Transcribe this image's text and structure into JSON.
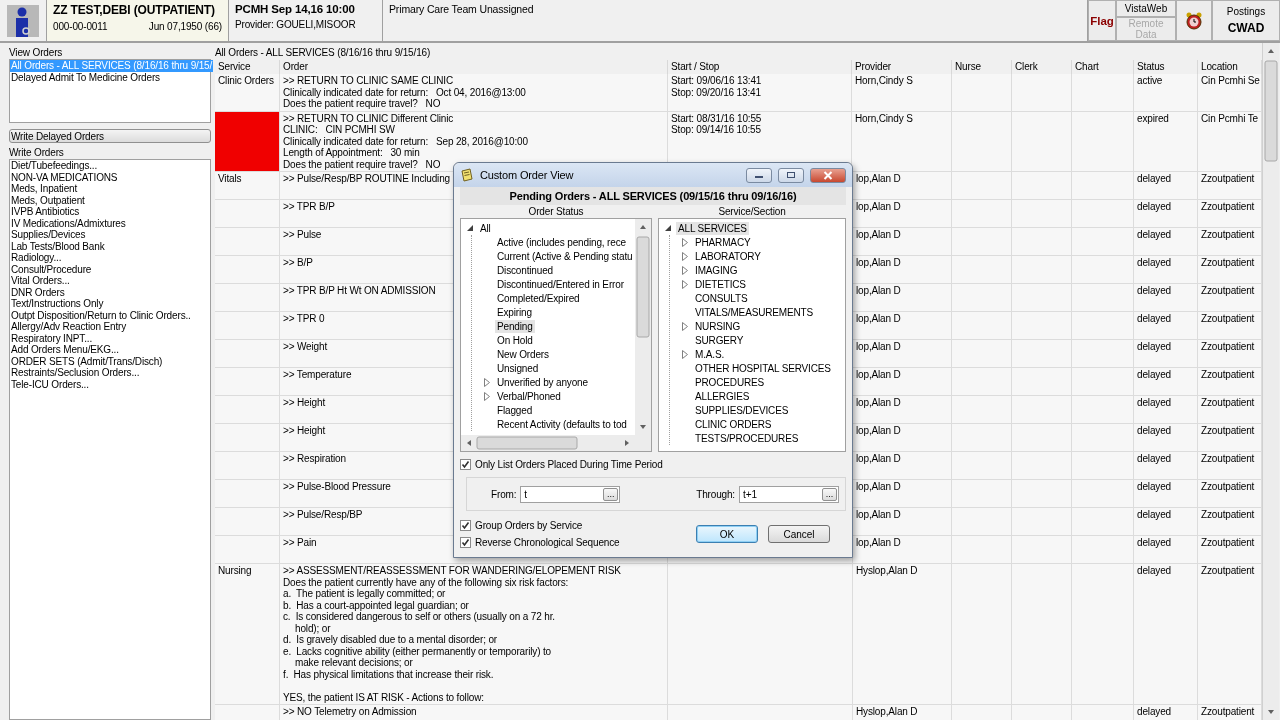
{
  "header": {
    "patient_name": "ZZ TEST,DEBI (OUTPATIENT)",
    "ssn": "000-00-0011",
    "dob": "Jun 07,1950 (66)",
    "encounter": "PCMH Sep 14,16 10:00",
    "provider": "Provider:  GOUELI,MISOOR",
    "team": "Primary Care Team Unassigned",
    "flag_button": "Flag",
    "vistaweb_button": {
      "label": "VistaWeb",
      "disabled": false
    },
    "remote_data_button": {
      "label": "Remote Data",
      "disabled": true
    },
    "postings_label": "Postings",
    "postings_value": "CWAD"
  },
  "view_orders": {
    "label": "View Orders",
    "items": [
      {
        "label": "All Orders - ALL SERVICES (8/16/16 thru 9/15/",
        "selected": true
      },
      {
        "label": "Delayed Admit To Medicine Orders",
        "selected": false
      }
    ]
  },
  "write_delayed_button": "Write Delayed Orders",
  "write_orders": {
    "label": "Write Orders",
    "items": [
      {
        "label": "Diet/Tubefeedings...",
        "selected": false
      },
      {
        "label": "NON-VA MEDICATIONS",
        "selected": false
      },
      {
        "label": "Meds, Inpatient",
        "selected": false
      },
      {
        "label": "Meds, Outpatient",
        "selected": false
      },
      {
        "label": "IVPB Antibiotics",
        "selected": false
      },
      {
        "label": "IV Medications/Admixtures",
        "selected": false
      },
      {
        "label": "Supplies/Devices",
        "selected": false
      },
      {
        "label": "Lab Tests/Blood Bank",
        "selected": false
      },
      {
        "label": "Radiology...",
        "selected": false
      },
      {
        "label": "Consult/Procedure",
        "selected": false
      },
      {
        "label": "Vital Orders...",
        "selected": false
      },
      {
        "label": "DNR Orders",
        "selected": false
      },
      {
        "label": "Text/Instructions Only",
        "selected": false
      },
      {
        "label": "Outpt Disposition/Return to Clinic Orders..",
        "selected": false
      },
      {
        "label": "Allergy/Adv Reaction Entry",
        "selected": false
      },
      {
        "label": "Respiratory INPT...",
        "selected": false
      },
      {
        "label": "Add Orders Menu/EKG...",
        "selected": false
      },
      {
        "label": "ORDER SETS (Admit/Trans/Disch)",
        "selected": false
      },
      {
        "label": "Restraints/Seclusion Orders...",
        "selected": false
      },
      {
        "label": "Tele-ICU Orders...",
        "selected": false
      }
    ]
  },
  "orders": {
    "title": "All Orders - ALL SERVICES (8/16/16 thru 9/15/16)",
    "columns": [
      "Service",
      "Order",
      "Start / Stop",
      "Provider",
      "Nurse",
      "Clerk",
      "Chart",
      "Status",
      "Location"
    ],
    "rows": [
      {
        "service": "Clinic Orders",
        "flagged": false,
        "order": [
          ">> RETURN TO CLINIC SAME CLINIC",
          "Clinically indicated date for return:   Oct 04, 2016@13:00",
          "Does the patient require travel?   NO"
        ],
        "start_stop": [
          "Start: 09/06/16 13:41",
          "Stop: 09/20/16 13:41"
        ],
        "provider": "Horn,Cindy S",
        "status": "active",
        "location": "Cin Pcmhi Se"
      },
      {
        "flagged": true,
        "order": [
          ">> RETURN TO CLINIC Different Clinic",
          "CLINIC:   CIN PCMHI SW",
          "Clinically indicated date for return:   Sep 28, 2016@10:00",
          "Length of Appointment:   30 min",
          "Does the patient require travel?   NO"
        ],
        "start_stop": [
          "Start: 08/31/16 10:55",
          "Stop: 09/14/16 10:55"
        ],
        "provider": "Horn,Cindy S",
        "status": "expired",
        "location": "Cin Pcmhi Te"
      },
      {
        "service": "Vitals",
        "flagged": false,
        "order": [
          ">> Pulse/Resp/BP ROUTINE Including"
        ],
        "provider": "lop,Alan D",
        "status": "delayed",
        "location": "Zzoutpatient"
      },
      {
        "flagged": false,
        "order": [
          ">> TPR B/P"
        ],
        "provider": "lop,Alan D",
        "status": "delayed",
        "location": "Zzoutpatient"
      },
      {
        "flagged": false,
        "order": [
          ">> Pulse"
        ],
        "provider": "lop,Alan D",
        "status": "delayed",
        "location": "Zzoutpatient"
      },
      {
        "flagged": false,
        "order": [
          ">> B/P"
        ],
        "provider": "lop,Alan D",
        "status": "delayed",
        "location": "Zzoutpatient"
      },
      {
        "flagged": false,
        "order": [
          ">> TPR B/P Ht Wt ON ADMISSION"
        ],
        "provider": "lop,Alan D",
        "status": "delayed",
        "location": "Zzoutpatient"
      },
      {
        "flagged": false,
        "order": [
          ">> TPR 0"
        ],
        "provider": "lop,Alan D",
        "status": "delayed",
        "location": "Zzoutpatient"
      },
      {
        "flagged": false,
        "order": [
          ">> Weight"
        ],
        "provider": "lop,Alan D",
        "status": "delayed",
        "location": "Zzoutpatient"
      },
      {
        "flagged": false,
        "order": [
          ">> Temperature"
        ],
        "provider": "lop,Alan D",
        "status": "delayed",
        "location": "Zzoutpatient"
      },
      {
        "flagged": false,
        "order": [
          ">> Height"
        ],
        "provider": "lop,Alan D",
        "status": "delayed",
        "location": "Zzoutpatient"
      },
      {
        "flagged": false,
        "order": [
          ">> Height"
        ],
        "provider": "lop,Alan D",
        "status": "delayed",
        "location": "Zzoutpatient"
      },
      {
        "flagged": false,
        "order": [
          ">> Respiration"
        ],
        "provider": "lop,Alan D",
        "status": "delayed",
        "location": "Zzoutpatient"
      },
      {
        "flagged": false,
        "order": [
          ">> Pulse-Blood Pressure"
        ],
        "provider": "lop,Alan D",
        "status": "delayed",
        "location": "Zzoutpatient"
      },
      {
        "flagged": false,
        "order": [
          ">> Pulse/Resp/BP"
        ],
        "provider": "lop,Alan D",
        "status": "delayed",
        "location": "Zzoutpatient"
      },
      {
        "flagged": false,
        "order": [
          ">> Pain"
        ],
        "provider": "lop,Alan D",
        "status": "delayed",
        "location": "Zzoutpatient"
      },
      {
        "service": "Nursing",
        "flagged": false,
        "order": [
          ">> ASSESSMENT/REASSESSMENT FOR WANDERING/ELOPEMENT RISK",
          "Does the patient currently have any of the following six risk factors:",
          "a.  The patient is legally committed; or",
          "b.  Has a court-appointed legal guardian; or",
          "c.  Is considered dangerous to self or others (usually on a 72 hr.",
          {
            "text": "hold); or",
            "indent": true
          },
          "d.  Is gravely disabled due to a mental disorder; or",
          "e.  Lacks cognitive ability (either permanently or temporarily) to",
          {
            "text": "make relevant decisions; or",
            "indent": true
          },
          "f.  Has physical limitations that increase their risk.",
          {
            "text": "YES, the patient IS AT RISK - Actions to follow:",
            "gap_before": true
          }
        ],
        "provider": "Hyslop,Alan D",
        "status": "delayed",
        "location": "Zzoutpatient"
      },
      {
        "flagged": false,
        "order": [
          ">> NO Telemetry on Admission"
        ],
        "provider": "Hyslop,Alan D",
        "status": "delayed",
        "location": "Zzoutpatient"
      }
    ]
  },
  "dialog": {
    "title": "Custom Order View",
    "heading": "Pending Orders - ALL SERVICES (09/15/16 thru 09/16/16)",
    "status_label": "Order Status",
    "status_tree": [
      {
        "label": "All",
        "kind": "group",
        "expanded": true,
        "selected": false,
        "children": [
          {
            "label": "Active (includes pending, rece",
            "kind": "leaf",
            "selected": false
          },
          {
            "label": "Current (Active & Pending statu",
            "kind": "leaf",
            "selected": false
          },
          {
            "label": "Discontinued",
            "kind": "leaf",
            "selected": false
          },
          {
            "label": "Discontinued/Entered in Error",
            "kind": "leaf",
            "selected": false
          },
          {
            "label": "Completed/Expired",
            "kind": "leaf",
            "selected": false
          },
          {
            "label": "Expiring",
            "kind": "leaf",
            "selected": false
          },
          {
            "label": "Pending",
            "kind": "leaf",
            "selected": true
          },
          {
            "label": "On Hold",
            "kind": "leaf",
            "selected": false
          },
          {
            "label": "New Orders",
            "kind": "leaf",
            "selected": false
          },
          {
            "label": "Unsigned",
            "kind": "leaf",
            "selected": false
          },
          {
            "label": "Unverified by anyone",
            "kind": "group",
            "expanded": false,
            "selected": false
          },
          {
            "label": "Verbal/Phoned",
            "kind": "group",
            "expanded": false,
            "selected": false
          },
          {
            "label": "Flagged",
            "kind": "leaf",
            "selected": false
          },
          {
            "label": "Recent Activity (defaults to tod",
            "kind": "leaf",
            "selected": false
          }
        ]
      }
    ],
    "service_label": "Service/Section",
    "service_tree": [
      {
        "label": "ALL SERVICES",
        "kind": "group",
        "expanded": true,
        "selected": true,
        "children": [
          {
            "label": "PHARMACY",
            "kind": "group",
            "expanded": false,
            "selected": false
          },
          {
            "label": "LABORATORY",
            "kind": "group",
            "expanded": false,
            "selected": false
          },
          {
            "label": "IMAGING",
            "kind": "group",
            "expanded": false,
            "selected": false
          },
          {
            "label": "DIETETICS",
            "kind": "group",
            "expanded": false,
            "selected": false
          },
          {
            "label": "CONSULTS",
            "kind": "leaf",
            "selected": false
          },
          {
            "label": "VITALS/MEASUREMENTS",
            "kind": "leaf",
            "selected": false
          },
          {
            "label": "NURSING",
            "kind": "group",
            "expanded": false,
            "selected": false
          },
          {
            "label": "SURGERY",
            "kind": "leaf",
            "selected": false
          },
          {
            "label": "M.A.S.",
            "kind": "group",
            "expanded": false,
            "selected": false
          },
          {
            "label": "OTHER HOSPITAL SERVICES",
            "kind": "leaf",
            "selected": false
          },
          {
            "label": "PROCEDURES",
            "kind": "leaf",
            "selected": false
          },
          {
            "label": "ALLERGIES",
            "kind": "leaf",
            "selected": false
          },
          {
            "label": "SUPPLIES/DEVICES",
            "kind": "leaf",
            "selected": false
          },
          {
            "label": "CLINIC ORDERS",
            "kind": "leaf",
            "selected": false
          },
          {
            "label": "TESTS/PROCEDURES",
            "kind": "leaf",
            "selected": false
          }
        ]
      }
    ],
    "time_period": {
      "label": "Only List Orders Placed During Time Period",
      "checked": true
    },
    "from": {
      "label": "From:",
      "value": "t",
      "picker": "..."
    },
    "through": {
      "label": "Through:",
      "value": "t+1",
      "picker": "..."
    },
    "options": [
      {
        "label": "Group Orders by Service",
        "checked": true
      },
      {
        "label": "Reverse Chronological Sequence",
        "checked": true
      }
    ],
    "ok_button": "OK",
    "cancel_button": "Cancel"
  }
}
